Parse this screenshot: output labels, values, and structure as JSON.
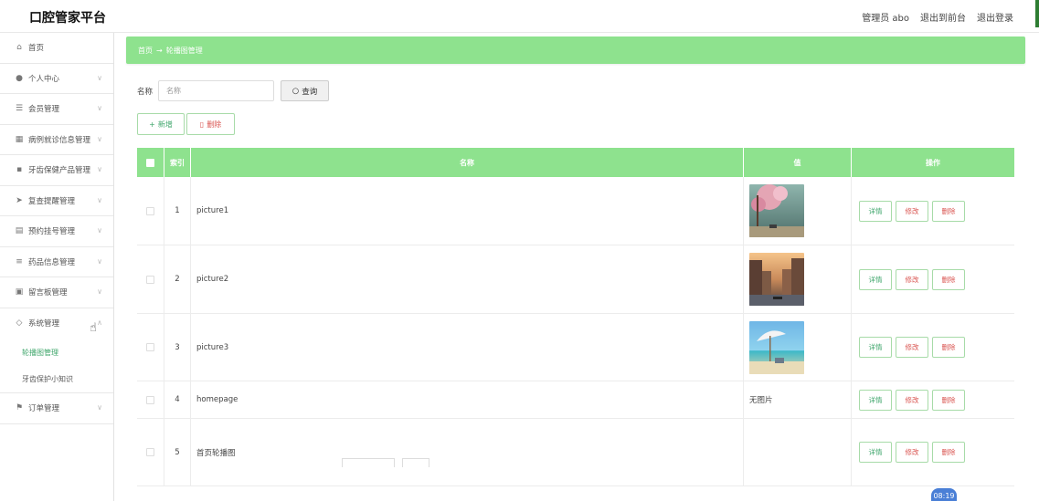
{
  "app": {
    "title": "口腔管家平台"
  },
  "header": {
    "admin_label": "管理员 abo",
    "to_front": "退出到前台",
    "logout": "退出登录"
  },
  "sidebar": {
    "items": [
      {
        "label": "首页",
        "icon": "home-icon"
      },
      {
        "label": "个人中心",
        "icon": "user-icon"
      },
      {
        "label": "会员管理",
        "icon": "sliders-icon"
      },
      {
        "label": "病例就诊信息管理",
        "icon": "grid-icon"
      },
      {
        "label": "牙齿保健产品管理",
        "icon": "apps-icon"
      },
      {
        "label": "复查提醒管理",
        "icon": "send-icon"
      },
      {
        "label": "预约挂号管理",
        "icon": "briefcase-icon"
      },
      {
        "label": "药品信息管理",
        "icon": "list-icon"
      },
      {
        "label": "留言板管理",
        "icon": "clipboard-icon"
      },
      {
        "label": "系统管理",
        "icon": "settings-icon"
      }
    ],
    "sub_items": [
      {
        "label": "轮播图管理",
        "active": true
      },
      {
        "label": "牙齿保护小知识",
        "active": false
      }
    ],
    "last_item": {
      "label": "订单管理",
      "icon": "flag-icon"
    }
  },
  "breadcrumb": {
    "home": "首页",
    "arrow": "→",
    "current": "轮播图管理"
  },
  "search": {
    "label": "名称",
    "placeholder": "名称",
    "button": "查询"
  },
  "actions": {
    "add": "新增",
    "delete": "删除"
  },
  "table": {
    "headers": {
      "index": "索引",
      "name": "名称",
      "image": "值",
      "ops": "操作"
    },
    "rows": [
      {
        "index": "1",
        "name": "picture1",
        "image": "cherry-blossom"
      },
      {
        "index": "2",
        "name": "picture2",
        "image": "venice-canal"
      },
      {
        "index": "3",
        "name": "picture3",
        "image": "beach-umbrella"
      },
      {
        "index": "4",
        "name": "homepage",
        "image_text": "无图片"
      },
      {
        "index": "5",
        "name": "首页轮播图",
        "image_text": ""
      }
    ],
    "op_labels": {
      "detail": "详情",
      "edit": "修改",
      "remove": "删除"
    }
  },
  "clock": "08:19",
  "colors": {
    "accent": "#8ee28e",
    "green_text": "#3fa66b",
    "red_text": "#d9534f"
  }
}
